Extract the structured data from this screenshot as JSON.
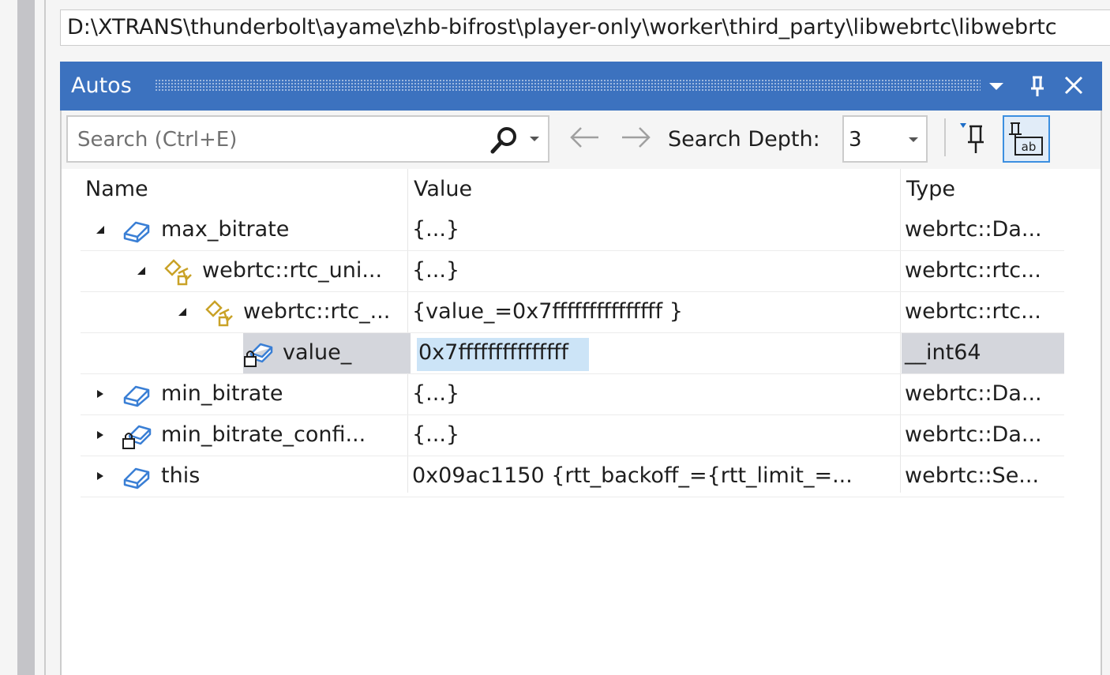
{
  "path_bar": {
    "text": "D:\\XTRANS\\thunderbolt\\ayame\\zhb-bifrost\\player-only\\worker\\third_party\\libwebrtc\\libwebrtc"
  },
  "window": {
    "title": "Autos"
  },
  "toolbar": {
    "search_placeholder": "Search (Ctrl+E)",
    "search_depth_label": "Search Depth:",
    "search_depth_value": "3"
  },
  "columns": {
    "name": "Name",
    "value": "Value",
    "type": "Type"
  },
  "rows": [
    {
      "name": "max_bitrate",
      "value": "{...}",
      "type": "webrtc::Da..."
    },
    {
      "name": "webrtc::rtc_uni...",
      "value": "{...}",
      "type": "webrtc::rtc..."
    },
    {
      "name": "webrtc::rtc_...",
      "value": "{value_=0x7fffffffffffffff }",
      "type": "webrtc::rtc..."
    },
    {
      "name": "value_",
      "value": "0x7fffffffffffffff",
      "type": "__int64"
    },
    {
      "name": "min_bitrate",
      "value": "{...}",
      "type": "webrtc::Da..."
    },
    {
      "name": "min_bitrate_confi...",
      "value": "{...}",
      "type": "webrtc::Da..."
    },
    {
      "name": "this",
      "value": "0x09ac1150 {rtt_backoff_={rtt_limit_=...",
      "type": "webrtc::Se..."
    }
  ],
  "colors": {
    "titlebar": "#3c72bf",
    "selection": "#d4d6dc",
    "edit_highlight": "#cce4f7",
    "member_icon": "#3a7fd5",
    "base_class_icon": "#c9a227"
  }
}
